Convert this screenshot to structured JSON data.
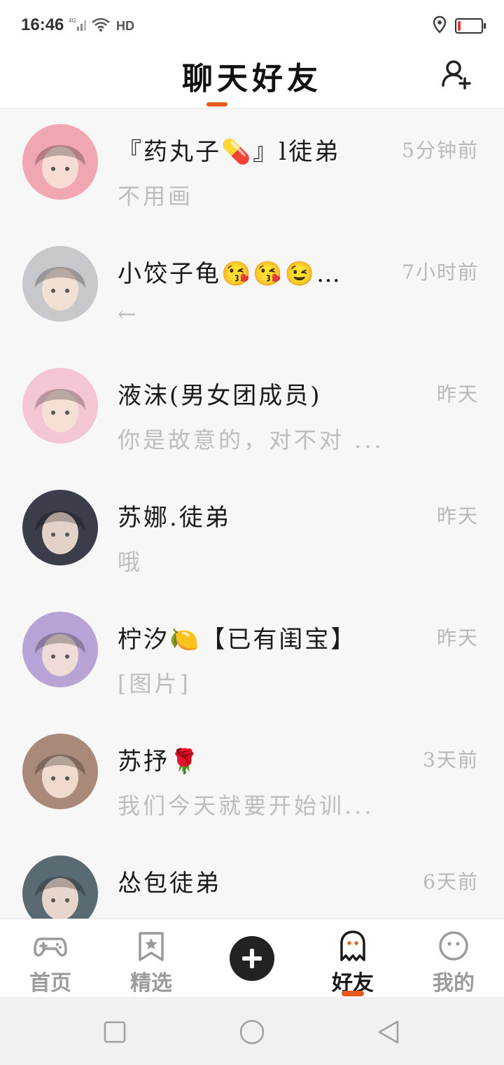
{
  "status_bar": {
    "time": "16:46",
    "network": "4G",
    "wifi_tag": "HD",
    "icons": [
      "signal-icon",
      "wifi-icon",
      "location-icon",
      "battery-icon"
    ],
    "battery_level": 0.12,
    "battery_color": "#e53935"
  },
  "header": {
    "title": "聊天好友",
    "accent_color": "#e85a1b",
    "add_friend_icon": "add-user-icon"
  },
  "chats": [
    {
      "name": "『药丸子💊』l徒弟",
      "time": "5分钟前",
      "preview": "不用画",
      "avatar_color": "#f1a7b1"
    },
    {
      "name": "小饺子龟😘😘😉…",
      "time": "7小时前",
      "preview": "←",
      "avatar_color": "#c8c8cc"
    },
    {
      "name": "液沫(男女团成员)",
      "time": "昨天",
      "preview": "你是故意的，对不对 ...",
      "avatar_color": "#f4c6d3"
    },
    {
      "name": "苏娜.徒弟",
      "time": "昨天",
      "preview": "哦",
      "avatar_color": "#3b3d4a"
    },
    {
      "name": "柠汐🍋【已有闺宝】",
      "time": "昨天",
      "preview": "[图片]",
      "avatar_color": "#b8a3d6"
    },
    {
      "name": "苏抒🌹",
      "time": "3天前",
      "preview": "我们今天就要开始训...",
      "avatar_color": "#a98a7a"
    },
    {
      "name": "怂包徒弟",
      "time": "6天前",
      "preview": "",
      "avatar_color": "#5a6a72"
    }
  ],
  "bottom_nav": {
    "items": [
      {
        "label": "首页",
        "icon": "gamepad-icon",
        "active": false
      },
      {
        "label": "精选",
        "icon": "star-bookmark-icon",
        "active": false
      },
      {
        "label": "",
        "icon": "plus-icon",
        "active": false
      },
      {
        "label": "好友",
        "icon": "ghost-icon",
        "active": true
      },
      {
        "label": "我的",
        "icon": "smiley-icon",
        "active": false
      }
    ]
  },
  "system_nav": {
    "icons": [
      "recent-apps-icon",
      "home-icon",
      "back-icon"
    ]
  }
}
